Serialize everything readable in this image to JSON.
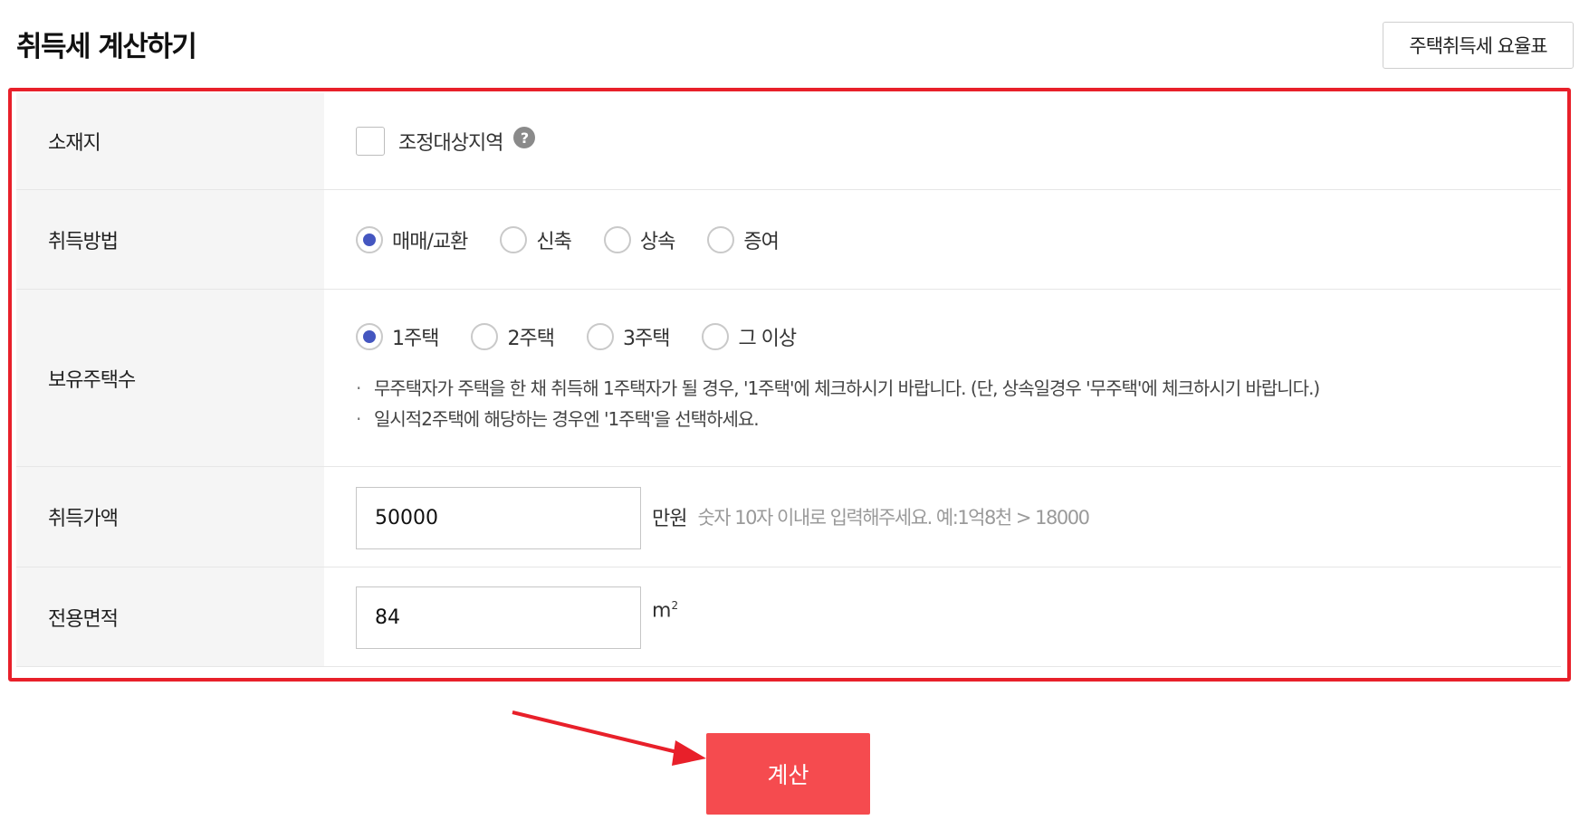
{
  "page": {
    "title": "취득세 계산하기",
    "rate_table_button": "주택취득세 요율표"
  },
  "form": {
    "location": {
      "label": "소재지",
      "checkbox_label": "조정대상지역",
      "checked": false,
      "help_icon": "?"
    },
    "method": {
      "label": "취득방법",
      "options": [
        "매매/교환",
        "신축",
        "상속",
        "증여"
      ],
      "selected": "매매/교환"
    },
    "houses": {
      "label": "보유주택수",
      "options": [
        "1주택",
        "2주택",
        "3주택",
        "그 이상"
      ],
      "selected": "1주택",
      "notes": [
        "무주택자가 주택을 한 채 취득해 1주택자가 될 경우, '1주택'에 체크하시기 바랍니다. (단, 상속일경우 '무주택'에 체크하시기 바랍니다.)",
        "일시적2주택에 해당하는 경우엔 '1주택'을 선택하세요."
      ],
      "note_bullet": "·"
    },
    "price": {
      "label": "취득가액",
      "value": "50000",
      "unit": "만원",
      "hint": "숫자 10자 이내로 입력해주세요. 예:1억8천 > 18000"
    },
    "area": {
      "label": "전용면적",
      "value": "84",
      "unit_base": "m",
      "unit_sup": "2"
    }
  },
  "calculate_button": "계산",
  "colors": {
    "highlight": "#e8202a",
    "accent_radio": "#4456c0",
    "calc_button": "#f54b4f"
  }
}
